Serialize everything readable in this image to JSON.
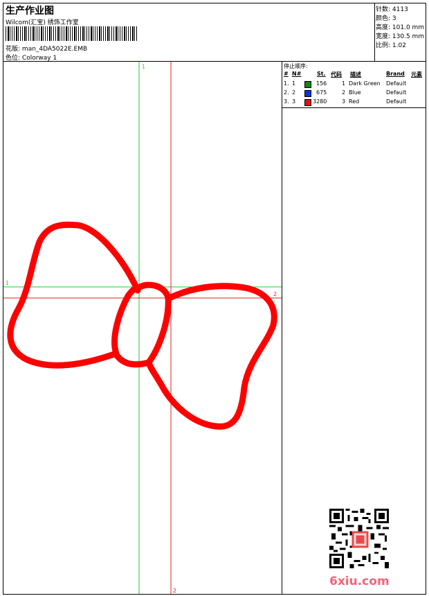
{
  "header": {
    "title": "生产作业图",
    "company": "Wilcom(汇宝) 绣饰工作室",
    "design_label": "花版:",
    "design_value": "man_4DA5022E.EMB",
    "colorway_label": "色位:",
    "colorway_value": "Colorway 1"
  },
  "stats": [
    {
      "label": "针数:",
      "value": "4113"
    },
    {
      "label": "颜色:",
      "value": "3"
    },
    {
      "label": "高度:",
      "value": "101.0 mm"
    },
    {
      "label": "宽度:",
      "value": "130.5 mm"
    },
    {
      "label": "比例:",
      "value": "1.02"
    }
  ],
  "legend": {
    "title": "停止顺序:",
    "columns": [
      "#",
      "N#",
      "St.",
      "代码",
      "描述",
      "Brand",
      "元素"
    ],
    "rows": [
      {
        "num": "1.",
        "needle": "1",
        "color": "#0a8a0a",
        "stitches": "156",
        "code": "1",
        "desc": "Dark Green",
        "brand": "Default"
      },
      {
        "num": "2.",
        "needle": "2",
        "color": "#1030e0",
        "stitches": "675",
        "code": "2",
        "desc": "Blue",
        "brand": "Default"
      },
      {
        "num": "3.",
        "needle": "3",
        "color": "#e01010",
        "stitches": "3280",
        "code": "3",
        "desc": "Red",
        "brand": "Default"
      }
    ]
  },
  "guides": {
    "green_label_top": "1",
    "green_label_left": "1",
    "red_label_right": "2",
    "red_label_bottom": "2",
    "green_color": "#22cc22",
    "red_color": "#e02020"
  },
  "design_color": "#ff0000",
  "watermark": "6xiu.com"
}
